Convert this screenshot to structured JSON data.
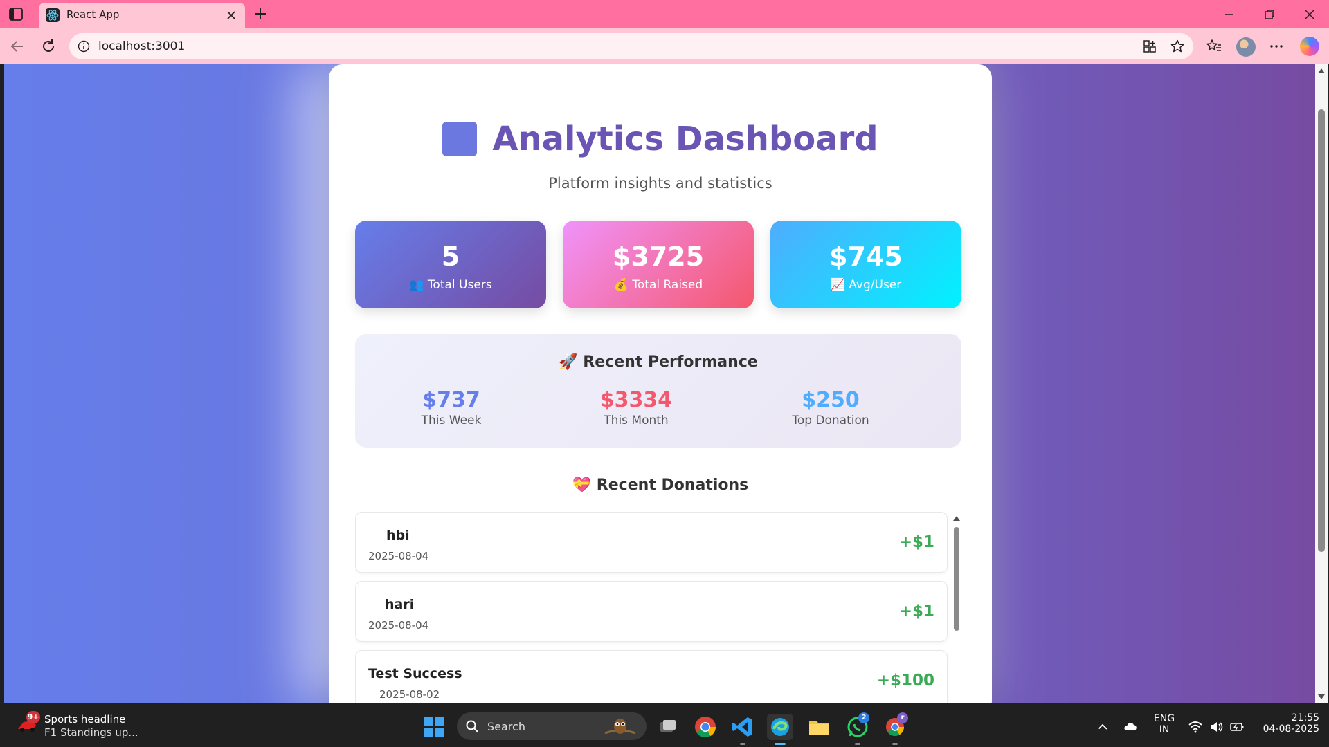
{
  "browser": {
    "tab_title": "React App",
    "url": "localhost:3001",
    "accent": "#ff6f9f"
  },
  "dashboard": {
    "title": "Analytics Dashboard",
    "subtitle": "Platform insights and statistics",
    "stats": [
      {
        "value": "5",
        "icon": "👥",
        "label": "Total Users",
        "gradient": [
          "#667eea",
          "#764ba2"
        ]
      },
      {
        "value": "$3725",
        "icon": "💰",
        "label": "Total Raised",
        "gradient": [
          "#f093fb",
          "#f5576c"
        ]
      },
      {
        "value": "$745",
        "icon": "📈",
        "label": "Avg/User",
        "gradient": [
          "#4facfe",
          "#00f2fe"
        ]
      }
    ],
    "performance": {
      "icon": "🚀",
      "title": "Recent Performance",
      "items": [
        {
          "value": "$737",
          "label": "This Week",
          "color": "#667eea"
        },
        {
          "value": "$3334",
          "label": "This Month",
          "color": "#f5576c"
        },
        {
          "value": "$250",
          "label": "Top Donation",
          "color": "#4facfe"
        }
      ]
    },
    "donations": {
      "icon": "💝",
      "title": "Recent Donations",
      "items": [
        {
          "name": "hbi",
          "date": "2025-08-04",
          "amount": "+$1"
        },
        {
          "name": "hari",
          "date": "2025-08-04",
          "amount": "+$1"
        },
        {
          "name": "Test Success",
          "date": "2025-08-02",
          "amount": "+$100"
        }
      ]
    }
  },
  "taskbar": {
    "news_badge": "9+",
    "news_title": "Sports headline",
    "news_subtitle": "F1 Standings up...",
    "search_placeholder": "Search",
    "whatsapp_badge": "2",
    "chrome_profile_badge": "r",
    "language_top": "ENG",
    "language_bottom": "IN",
    "time": "21:55",
    "date": "04-08-2025"
  }
}
